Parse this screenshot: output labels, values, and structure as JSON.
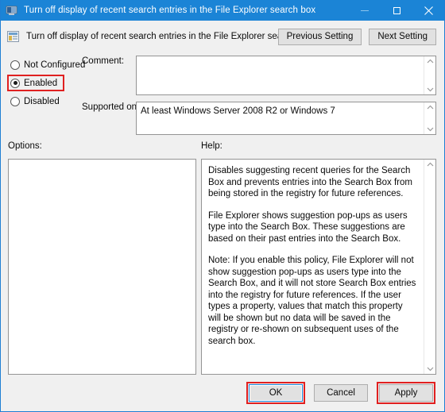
{
  "window": {
    "title": "Turn off display of recent search entries in the File Explorer search box",
    "icon": "policy-setting-icon",
    "controls": {
      "minimize": "minimize-icon",
      "maximize": "maximize-icon",
      "close": "close-icon"
    }
  },
  "header": {
    "icon": "policy-setting-icon",
    "policy_name": "Turn off display of recent search entries in the File Explorer search box",
    "previous_setting": "Previous Setting",
    "next_setting": "Next Setting"
  },
  "state": {
    "options": [
      {
        "label": "Not Configured",
        "selected": false,
        "highlighted": false
      },
      {
        "label": "Enabled",
        "selected": true,
        "highlighted": true
      },
      {
        "label": "Disabled",
        "selected": false,
        "highlighted": false
      }
    ]
  },
  "fields": {
    "comment_label": "Comment:",
    "comment_value": "",
    "supported_label": "Supported on:",
    "supported_value": "At least Windows Server 2008 R2 or Windows 7"
  },
  "panels": {
    "options_label": "Options:",
    "options_content": "",
    "help_label": "Help:",
    "help_paragraphs": [
      "Disables suggesting recent queries for the Search Box and prevents entries into the Search Box from being stored in the registry for future references.",
      "File Explorer shows suggestion pop-ups as users type into the Search Box.  These suggestions are based on their past entries into the Search Box.",
      "Note: If you enable this policy, File Explorer will not show suggestion pop-ups as users type into the Search Box, and it will not store Search Box entries into the registry for future references.  If the user types a property, values that match this property will be shown but no data will be saved in the registry or re-shown on subsequent uses of the search box."
    ]
  },
  "footer": {
    "ok": "OK",
    "cancel": "Cancel",
    "apply": "Apply"
  },
  "colors": {
    "titlebar": "#1b84d6",
    "highlight_red": "#e02020",
    "dialog_bg": "#f0f0f0"
  }
}
